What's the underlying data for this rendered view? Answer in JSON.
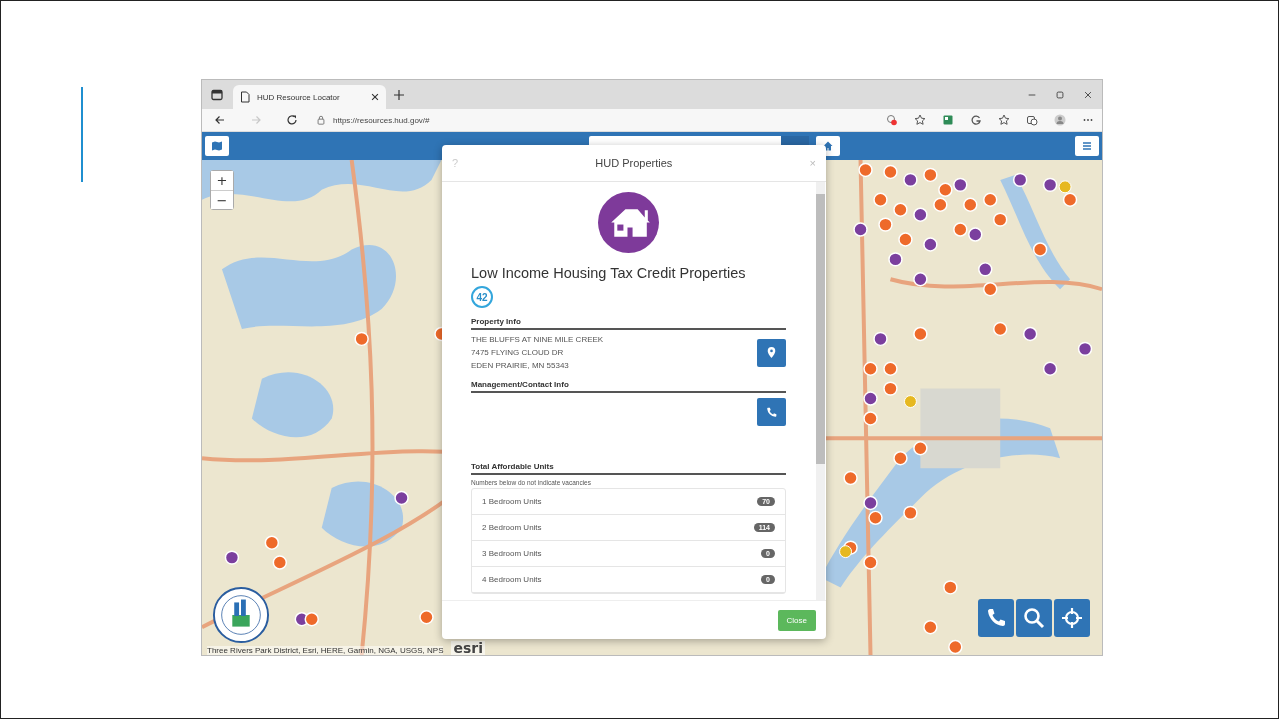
{
  "browser": {
    "tab_title": "HUD Resource Locator",
    "url": "https://resources.hud.gov/#",
    "forward_disabled": true
  },
  "modal": {
    "title": "HUD Properties",
    "help": "?",
    "close_x": "×",
    "heading": "Low Income Housing Tax Credit Properties",
    "count": "42",
    "property_section": "Property Info",
    "address_lines": [
      "THE BLUFFS AT NINE MILE CREEK",
      "7475 FLYING CLOUD DR",
      "EDEN PRAIRIE, MN 55343"
    ],
    "contact_section": "Management/Contact Info",
    "units_section": "Total Affordable Units",
    "units_note": "Numbers below do not indicate vacancies",
    "units": [
      {
        "label": "1 Bedroom Units",
        "count": "70"
      },
      {
        "label": "2 Bedroom Units",
        "count": "114"
      },
      {
        "label": "3 Bedroom Units",
        "count": "0"
      },
      {
        "label": "4 Bedroom Units",
        "count": "0"
      }
    ],
    "close_button": "Close"
  },
  "map": {
    "zoom_in": "+",
    "zoom_out": "−",
    "attribution": "Three Rivers Park District, Esri, HERE, Garmin, NGA, USGS, NPS",
    "provider_logo": "esri"
  }
}
